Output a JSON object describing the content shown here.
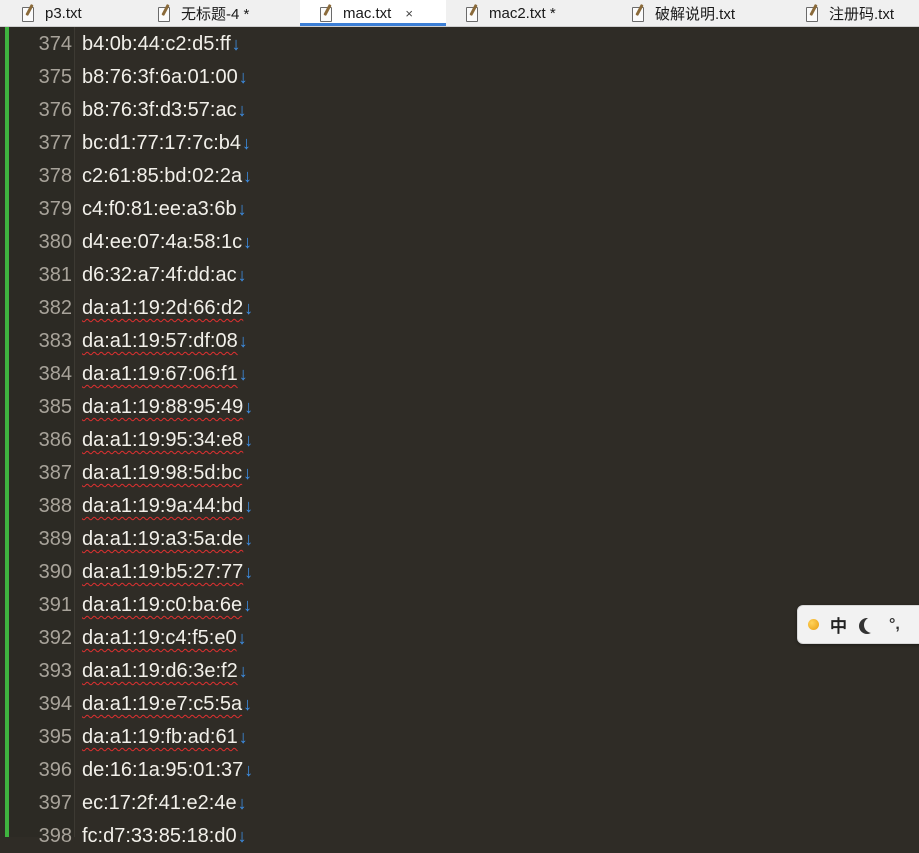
{
  "tabs": [
    {
      "label": "p3.txt"
    },
    {
      "label": "无标题-4 *"
    },
    {
      "label": "mac.txt",
      "close": "×"
    },
    {
      "label": "mac2.txt *"
    },
    {
      "label": "破解说明.txt"
    },
    {
      "label": "注册码.txt"
    }
  ],
  "newline_marker": "↓",
  "lines": [
    {
      "num": "374",
      "text": "b4:0b:44:c2:d5:ff",
      "squiggle": false
    },
    {
      "num": "375",
      "text": "b8:76:3f:6a:01:00",
      "squiggle": false
    },
    {
      "num": "376",
      "text": "b8:76:3f:d3:57:ac",
      "squiggle": false
    },
    {
      "num": "377",
      "text": "bc:d1:77:17:7c:b4",
      "squiggle": false
    },
    {
      "num": "378",
      "text": "c2:61:85:bd:02:2a",
      "squiggle": false
    },
    {
      "num": "379",
      "text": "c4:f0:81:ee:a3:6b",
      "squiggle": false
    },
    {
      "num": "380",
      "text": "d4:ee:07:4a:58:1c",
      "squiggle": false
    },
    {
      "num": "381",
      "text": "d6:32:a7:4f:dd:ac",
      "squiggle": false
    },
    {
      "num": "382",
      "text": "da:a1:19:2d:66:d2",
      "squiggle": true
    },
    {
      "num": "383",
      "text": "da:a1:19:57:df:08",
      "squiggle": true
    },
    {
      "num": "384",
      "text": "da:a1:19:67:06:f1",
      "squiggle": true
    },
    {
      "num": "385",
      "text": "da:a1:19:88:95:49",
      "squiggle": true
    },
    {
      "num": "386",
      "text": "da:a1:19:95:34:e8",
      "squiggle": true
    },
    {
      "num": "387",
      "text": "da:a1:19:98:5d:bc",
      "squiggle": true
    },
    {
      "num": "388",
      "text": "da:a1:19:9a:44:bd",
      "squiggle": true
    },
    {
      "num": "389",
      "text": "da:a1:19:a3:5a:de",
      "squiggle": true
    },
    {
      "num": "390",
      "text": "da:a1:19:b5:27:77",
      "squiggle": true
    },
    {
      "num": "391",
      "text": "da:a1:19:c0:ba:6e",
      "squiggle": true
    },
    {
      "num": "392",
      "text": "da:a1:19:c4:f5:e0",
      "squiggle": true
    },
    {
      "num": "393",
      "text": "da:a1:19:d6:3e:f2",
      "squiggle": true
    },
    {
      "num": "394",
      "text": "da:a1:19:e7:c5:5a",
      "squiggle": true
    },
    {
      "num": "395",
      "text": "da:a1:19:fb:ad:61",
      "squiggle": true
    },
    {
      "num": "396",
      "text": "de:16:1a:95:01:37",
      "squiggle": false
    },
    {
      "num": "397",
      "text": "ec:17:2f:41:e2:4e",
      "squiggle": false
    },
    {
      "num": "398",
      "text": "fc:d7:33:85:18:d0",
      "squiggle": false
    }
  ],
  "ime": {
    "lang": "中",
    "punct": "°,",
    "icons": [
      "ime-status-dot-icon",
      "moon-icon",
      "punctuation-icon"
    ]
  },
  "colors": {
    "background": "#2f2c26",
    "text": "#f2f0ea",
    "line_number": "#a8a39a",
    "newline_marker": "#3d8fe6",
    "change_bar": "#3fb33f",
    "active_tab_underline": "#3c7fd6",
    "squiggle": "#e03030"
  }
}
